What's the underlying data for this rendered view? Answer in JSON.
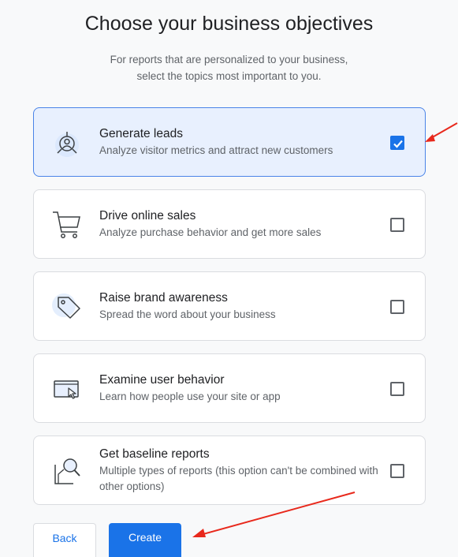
{
  "page": {
    "title": "Choose your business objectives",
    "subtitle_line1": "For reports that are personalized to your business,",
    "subtitle_line2": "select the topics most important to you."
  },
  "objectives": [
    {
      "label": "Generate leads",
      "description": "Analyze visitor metrics and attract new customers",
      "checked": true,
      "icon": "target-user-icon"
    },
    {
      "label": "Drive online sales",
      "description": "Analyze purchase behavior and get more sales",
      "checked": false,
      "icon": "shopping-cart-icon"
    },
    {
      "label": "Raise brand awareness",
      "description": "Spread the word about your business",
      "checked": false,
      "icon": "tag-icon"
    },
    {
      "label": "Examine user behavior",
      "description": "Learn how people use your site or app",
      "checked": false,
      "icon": "browser-cursor-icon"
    },
    {
      "label": "Get baseline reports",
      "description": "Multiple types of reports (this option can't be combined with other options)",
      "checked": false,
      "icon": "report-magnifier-icon"
    }
  ],
  "buttons": {
    "back": "Back",
    "create": "Create"
  },
  "colors": {
    "accent": "#1a73e8",
    "selected_bg": "#e8f0fe",
    "annotation_arrow": "#e8291c"
  }
}
